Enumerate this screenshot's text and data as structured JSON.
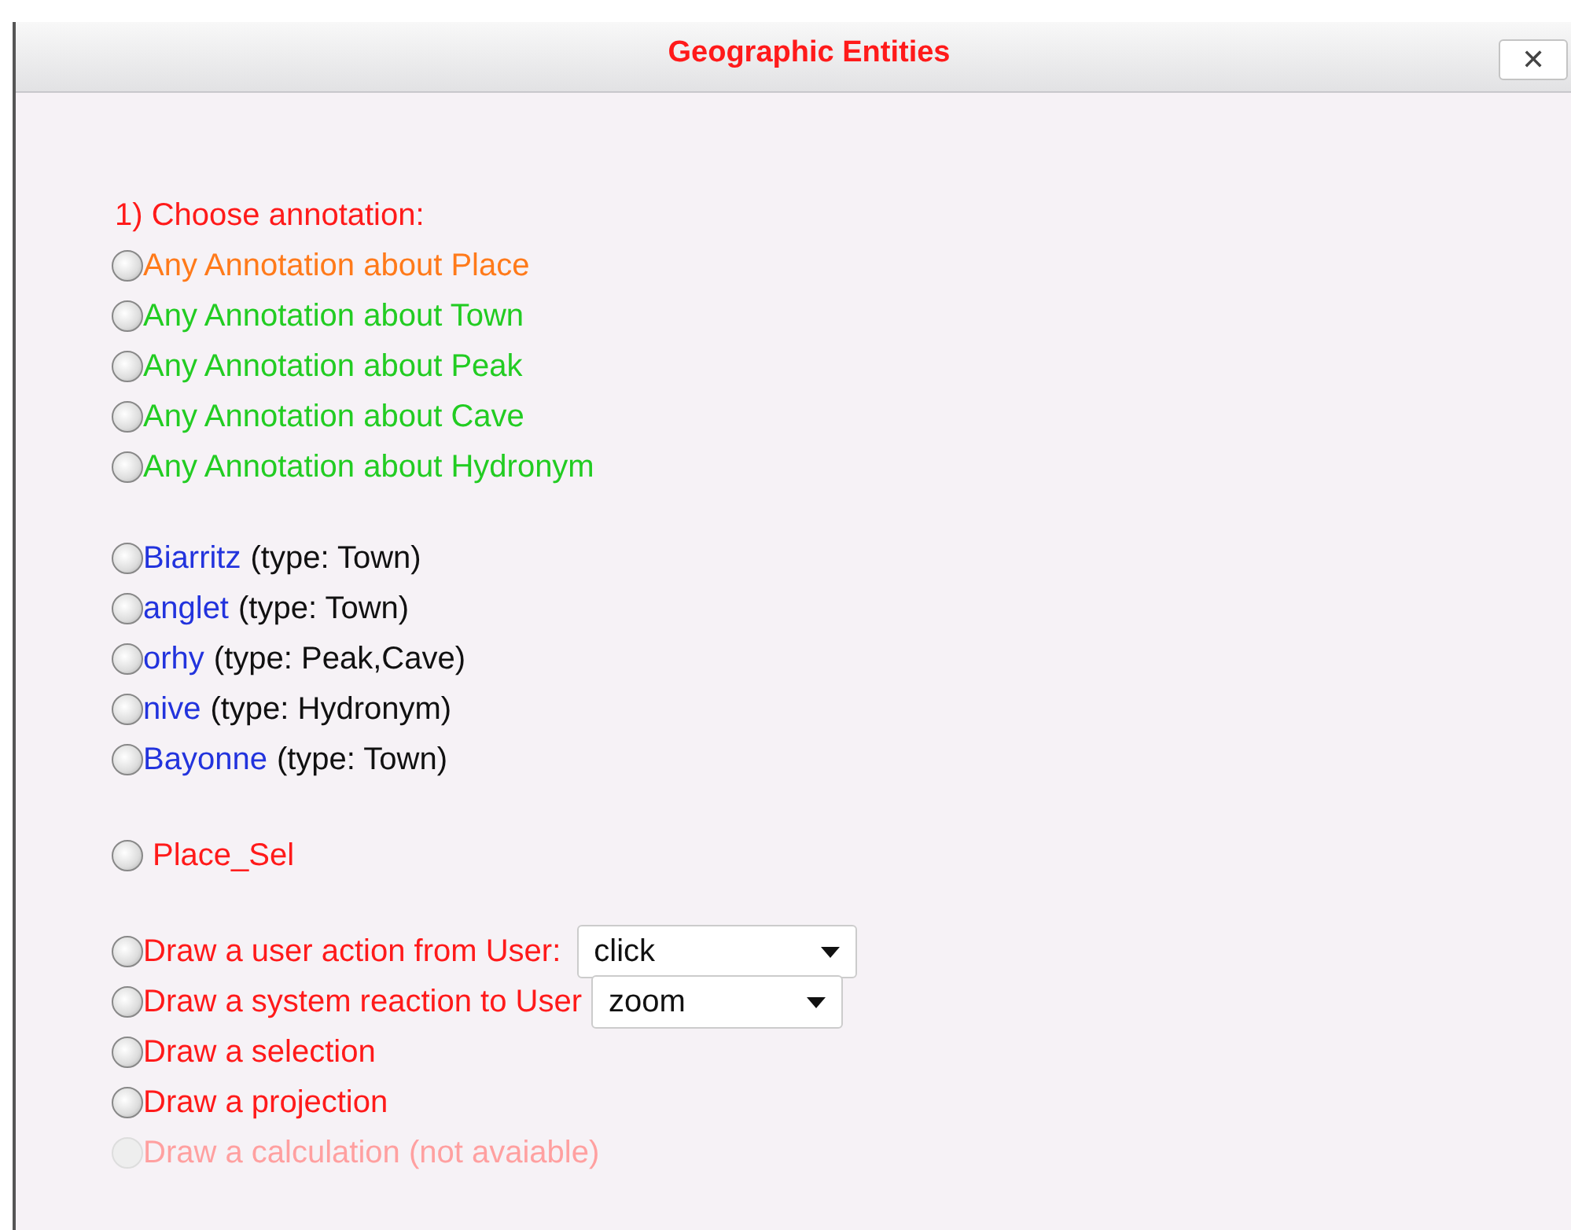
{
  "dialog": {
    "title": "Geographic Entities",
    "close_label": "✕"
  },
  "heading": "1) Choose annotation:",
  "annotations": [
    {
      "label": "Any Annotation about Place",
      "color": "#ff7a1a",
      "selected": false
    },
    {
      "label": "Any Annotation about Town",
      "color": "#22cc22",
      "selected": false
    },
    {
      "label": "Any Annotation about Peak",
      "color": "#22cc22",
      "selected": false
    },
    {
      "label": "Any Annotation about Cave",
      "color": "#22cc22",
      "selected": false
    },
    {
      "label": "Any Annotation about Hydronym",
      "color": "#22cc22",
      "selected": false
    }
  ],
  "entities": [
    {
      "name": "Biarritz",
      "type_text": "(type: Town)",
      "selected": false
    },
    {
      "name": "anglet",
      "type_text": "(type: Town)",
      "selected": false
    },
    {
      "name": "orhy",
      "type_text": "(type: Peak,Cave)",
      "selected": false
    },
    {
      "name": "nive",
      "type_text": "(type: Hydronym)",
      "selected": false
    },
    {
      "name": "Bayonne",
      "type_text": "(type: Town)",
      "selected": false
    }
  ],
  "place_option": {
    "label": "Place_Sel",
    "selected": false
  },
  "actions": [
    {
      "kind": "dropdown",
      "label": "Draw a user action from User:",
      "value": "click",
      "selected": false,
      "disabled": false
    },
    {
      "kind": "dropdown",
      "label": "Draw a system reaction to User",
      "value": "zoom",
      "selected": false,
      "disabled": false
    },
    {
      "kind": "plain",
      "label": "Draw a selection",
      "selected": false,
      "disabled": false
    },
    {
      "kind": "plain",
      "label": "Draw a projection",
      "selected": false,
      "disabled": false
    },
    {
      "kind": "plain",
      "label": "Draw a calculation (not avaiable)",
      "selected": false,
      "disabled": true
    }
  ]
}
